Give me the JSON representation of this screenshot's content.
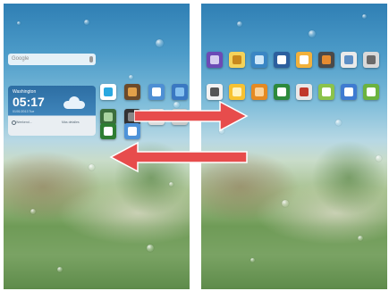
{
  "left_screen": {
    "search": {
      "placeholder": "Google"
    },
    "weather": {
      "city": "Washington",
      "time": "05:17",
      "date": "01/01/2013 Tue",
      "left_action": "Weekend...",
      "right_action": "Más detalles"
    },
    "apps": [
      {
        "icon": "play-store-icon",
        "color": "#ffffff",
        "glyph": "#2aa8e0"
      },
      {
        "icon": "gallery-icon",
        "color": "#6b4a2b",
        "glyph": "#e1a04a"
      },
      {
        "icon": "email-icon",
        "color": "#4e8fd4",
        "glyph": "#ffffff"
      },
      {
        "icon": "browser-icon",
        "color": "#3a78c2",
        "glyph": "#86c2f0"
      },
      {
        "icon": "photo-icon",
        "color": "#3c6e3d",
        "glyph": "#a9d3a0"
      },
      {
        "icon": "camera-icon",
        "color": "#333333",
        "glyph": "#888888"
      },
      {
        "icon": "app-icon",
        "color": "#dddddd",
        "glyph": "#a0a0a0"
      },
      {
        "icon": "huawei-icon",
        "color": "#c9c9c9",
        "glyph": "#c0392b"
      },
      {
        "icon": "phone-icon",
        "color": "#2e7d32",
        "glyph": "#ffffff"
      },
      {
        "icon": "messages-icon",
        "color": "#4e93d8",
        "glyph": "#ffffff"
      }
    ]
  },
  "right_screen": {
    "apps_row1": [
      {
        "icon": "camera-lens-icon",
        "color": "#6c4bb6",
        "glyph": "#d7cef0"
      },
      {
        "icon": "notes-icon",
        "color": "#f5d35a",
        "glyph": "#c9891d"
      },
      {
        "icon": "twitter-icon",
        "color": "#3a86c4",
        "glyph": "#cde7f9"
      },
      {
        "icon": "video-icon",
        "color": "#2c5f9e",
        "glyph": "#ffffff"
      },
      {
        "icon": "weather-icon",
        "color": "#f2b13b",
        "glyph": "#ffffff"
      },
      {
        "icon": "calculator-icon",
        "color": "#4a4a4a",
        "glyph": "#e58b30"
      },
      {
        "icon": "contacts-icon",
        "color": "#eaeaea",
        "glyph": "#5d8fc5"
      },
      {
        "icon": "settings-icon",
        "color": "#d9d9d9",
        "glyph": "#6a6a6a"
      }
    ],
    "apps_row2": [
      {
        "icon": "clock-icon",
        "color": "#f2f2f2",
        "glyph": "#555555"
      },
      {
        "icon": "sun-icon",
        "color": "#f7c232",
        "glyph": "#fff3c0"
      },
      {
        "icon": "files-icon",
        "color": "#e58a22",
        "glyph": "#fbd39a"
      },
      {
        "icon": "download-icon",
        "color": "#2d8a3c",
        "glyph": "#ffffff"
      },
      {
        "icon": "news-icon",
        "color": "#e8e8e8",
        "glyph": "#c0392b"
      },
      {
        "icon": "music-icon",
        "color": "#8bc34a",
        "glyph": "#ffffff"
      },
      {
        "icon": "store-icon",
        "color": "#3f7bd1",
        "glyph": "#ffffff"
      },
      {
        "icon": "sync-icon",
        "color": "#6cb33f",
        "glyph": "#ffffff"
      }
    ]
  },
  "arrows": {
    "right_arrow_color": "#e74c4c",
    "left_arrow_color": "#e74c4c"
  }
}
